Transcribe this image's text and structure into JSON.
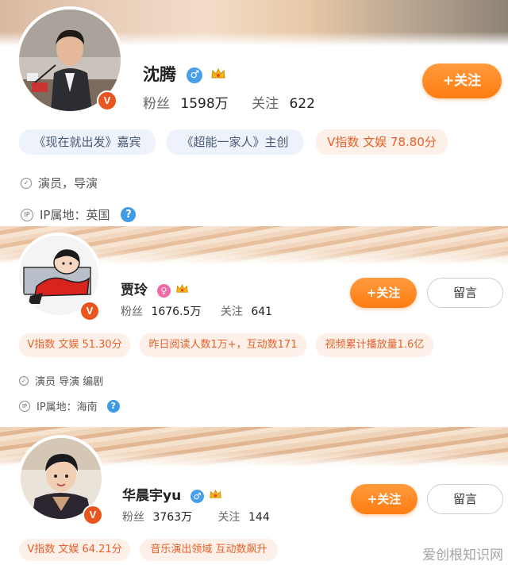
{
  "colors": {
    "follow": "#ff7d12",
    "verified": "#e8561d",
    "tag_orange_text": "#e8602a",
    "male": "#4aa0e8",
    "female": "#f06aa5",
    "help": "#3f9be5"
  },
  "profiles": [
    {
      "name": "沈腾",
      "gender_icon": "male-icon",
      "fans_label": "粉丝",
      "fans_value": "1598万",
      "follow_label": "关注",
      "follow_value": "622",
      "follow_button": "+关注",
      "tags": [
        "《现在就出发》嘉宾",
        "《超能一家人》主创",
        "V指数 文娱 78.80分"
      ],
      "profession": "演员，导演",
      "ip_location": "IP属地：英国",
      "verified_badge": "V"
    },
    {
      "name": "贾玲",
      "gender_icon": "female-icon",
      "fans_label": "粉丝",
      "fans_value": "1676.5万",
      "follow_label": "关注",
      "follow_value": "641",
      "follow_button": "+关注",
      "message_button": "留言",
      "tags": [
        "V指数 文娱 51.30分",
        "昨日阅读人数1万+，互动数171",
        "视频累计播放量1.6亿"
      ],
      "profession": "演员 导演 编剧",
      "ip_location": "IP属地：海南",
      "verified_badge": "V"
    },
    {
      "name": "华晨宇yu",
      "gender_icon": "male-icon",
      "fans_label": "粉丝",
      "fans_value": "3763万",
      "follow_label": "关注",
      "follow_value": "144",
      "follow_button": "+关注",
      "message_button": "留言",
      "tags": [
        "V指数 文娱 64.21分",
        "音乐演出领域 互动数飙升"
      ],
      "verified_badge": "V"
    }
  ],
  "watermark": "爱创根知识网"
}
